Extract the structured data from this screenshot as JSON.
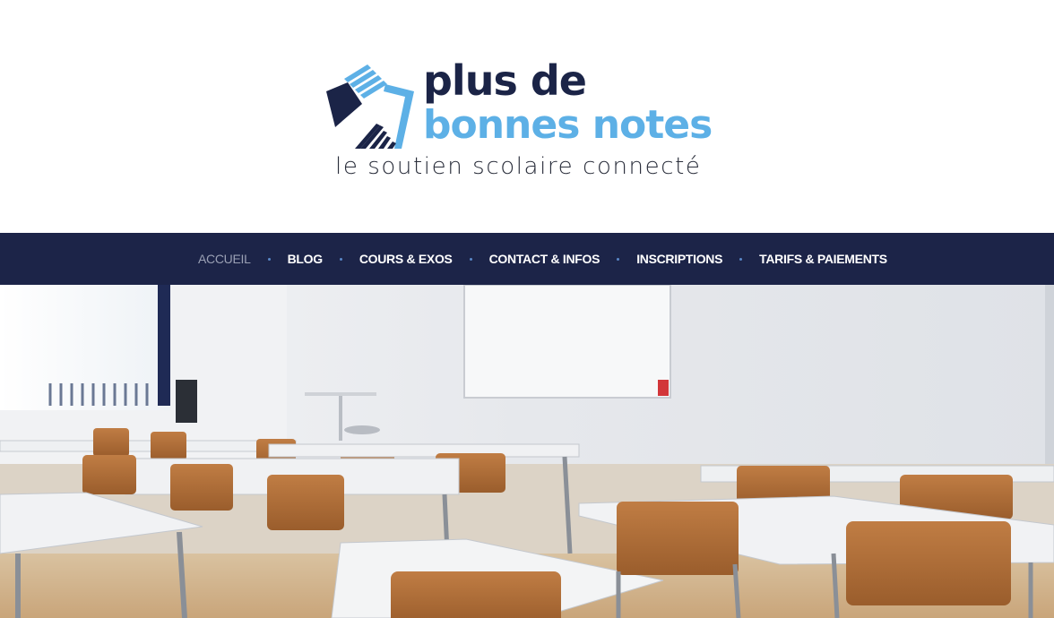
{
  "brand": {
    "line1": "plus de",
    "line2": "bonnes notes",
    "tagline": "le soutien scolaire connecté",
    "colors": {
      "navy": "#1b2447",
      "sky": "#5db0e6",
      "nav_bg": "#1c2448"
    }
  },
  "nav": {
    "items": [
      {
        "label": "ACCUEIL",
        "active": true
      },
      {
        "label": "BLOG",
        "active": false
      },
      {
        "label": "COURS & EXOS",
        "active": false
      },
      {
        "label": "CONTACT & INFOS",
        "active": false
      },
      {
        "label": "INSCRIPTIONS",
        "active": false
      },
      {
        "label": "TARIFS & PAIEMENTS",
        "active": false
      }
    ]
  },
  "hero": {
    "image": "classroom-photo"
  }
}
